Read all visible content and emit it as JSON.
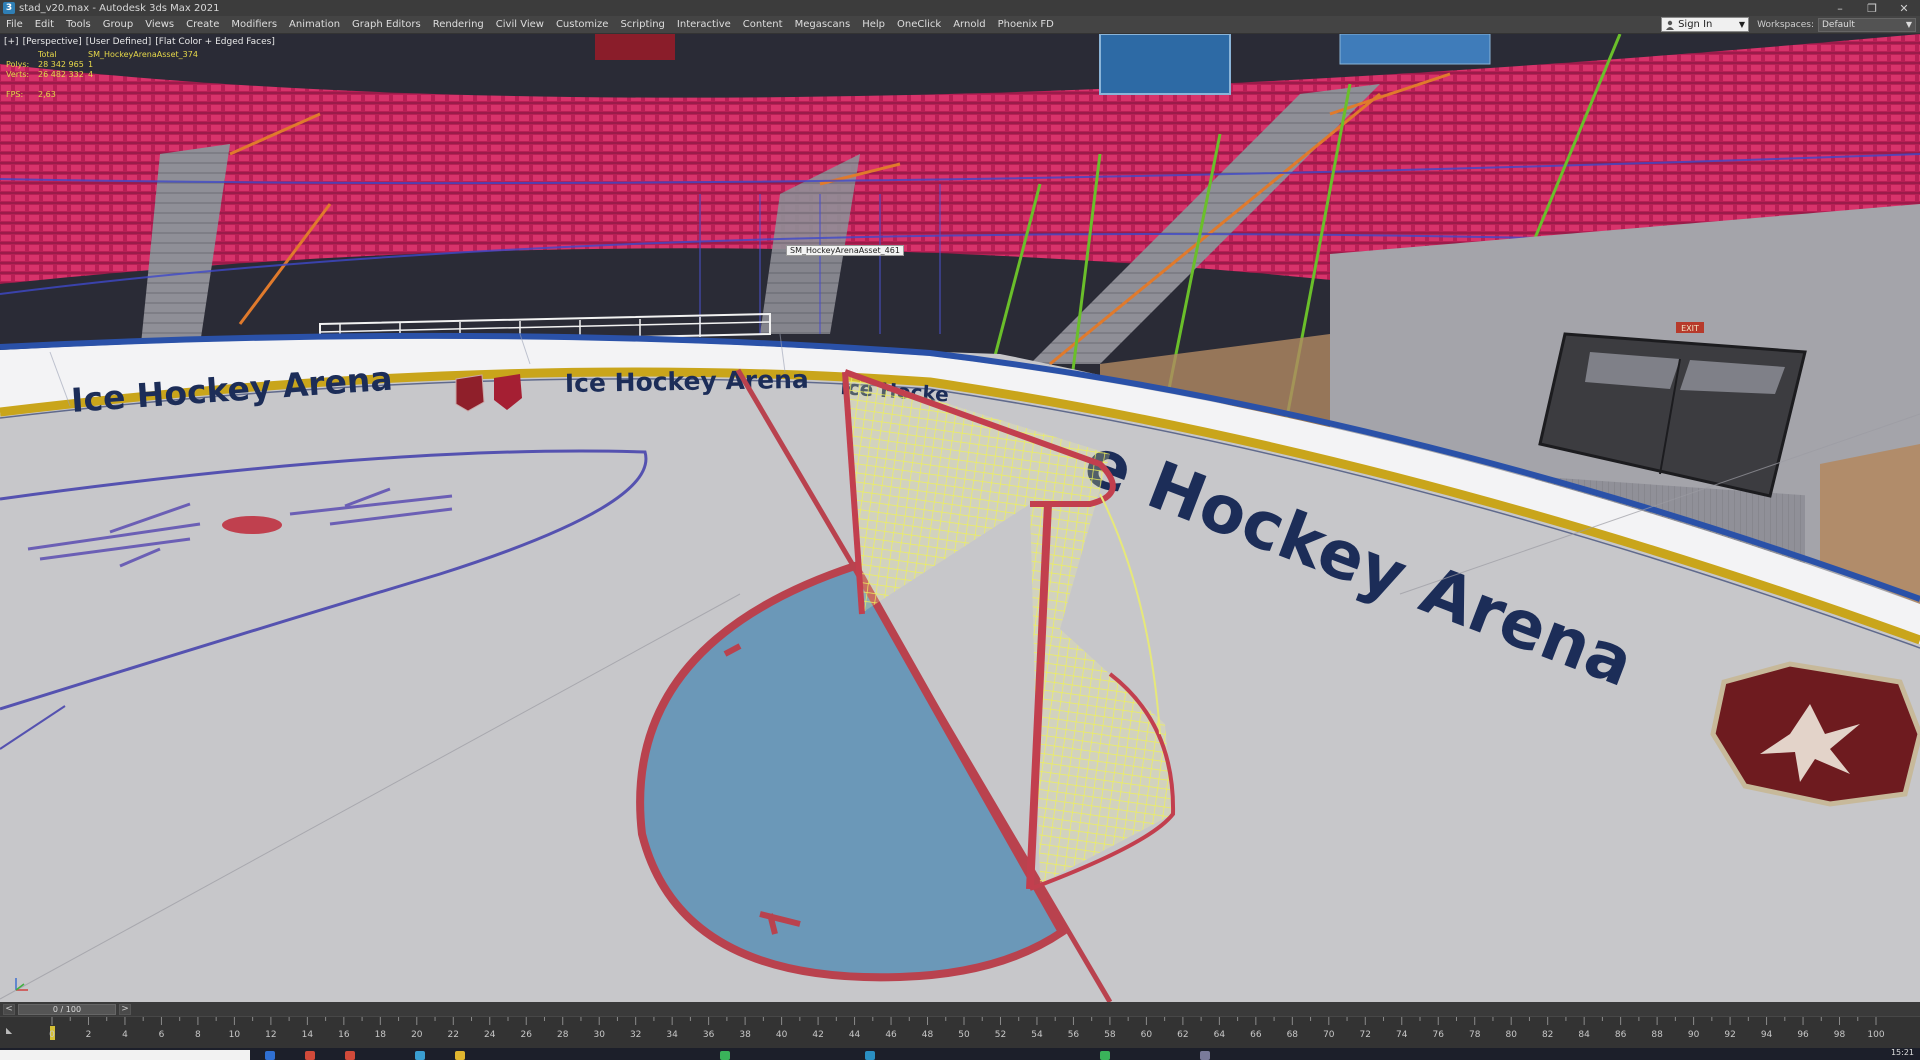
{
  "window": {
    "title": "stad_v20.max - Autodesk 3ds Max 2021",
    "controls": [
      "–",
      "❐",
      "✕"
    ]
  },
  "menu": {
    "items": [
      "File",
      "Edit",
      "Tools",
      "Group",
      "Views",
      "Create",
      "Modifiers",
      "Animation",
      "Graph Editors",
      "Rendering",
      "Civil View",
      "Customize",
      "Scripting",
      "Interactive",
      "Content",
      "Megascans",
      "Help",
      "OneClick",
      "Arnold",
      "Phoenix FD"
    ],
    "sign_in": "Sign In",
    "workspaces_label": "Workspaces:",
    "workspaces_value": "Default"
  },
  "viewport": {
    "labels": [
      "[+]",
      "[Perspective]",
      "[User Defined]",
      "[Flat Color + Edged Faces]"
    ],
    "stats": {
      "total_label": "Total",
      "selected_name": "SM_HockeyArenaAsset_374",
      "polys_label": "Polys:",
      "polys_total": "28 342 965",
      "polys_selected": "1",
      "verts_label": "Verts:",
      "verts_total": "26 482 332",
      "verts_selected": "4",
      "fps_label": "FPS:",
      "fps_value": "2,63"
    },
    "tooltip": "SM_HockeyArenaAsset_461",
    "board_text": [
      "Ice Hockey Arena",
      "Ice Hockey Arena",
      "Ice Hocke",
      "e Hockey Arena"
    ],
    "exit_sign": "EXIT",
    "colors": {
      "seats": "#c8245c",
      "ice": "#c9c9cb",
      "crease": "#6b98b8",
      "red_line": "#b9424e",
      "net": "#f2f28a",
      "board_text": "#1c2d58",
      "kickplate": "#c5a21a"
    }
  },
  "timeline": {
    "slider_text": "0 / 100",
    "prev": "<",
    "next": ">",
    "ticks": [
      "0",
      "2",
      "4",
      "6",
      "8",
      "10",
      "12",
      "14",
      "16",
      "18",
      "20",
      "22",
      "24",
      "26",
      "28",
      "30",
      "32",
      "34",
      "36",
      "38",
      "40",
      "42",
      "44",
      "46",
      "48",
      "50",
      "52",
      "54",
      "56",
      "58",
      "60",
      "62",
      "64",
      "66",
      "68",
      "70",
      "72",
      "74",
      "76",
      "78",
      "80",
      "82",
      "84",
      "86",
      "88",
      "90",
      "92",
      "94",
      "96",
      "98",
      "100"
    ]
  },
  "taskbar": {
    "clock": "15:21"
  }
}
